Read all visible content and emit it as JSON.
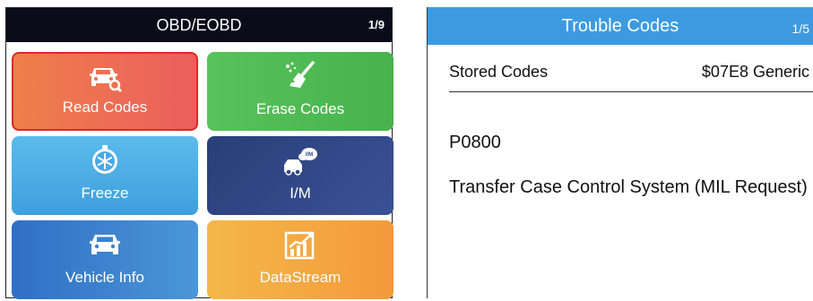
{
  "left_screen": {
    "title": "OBD/EOBD",
    "page": "1/9",
    "tiles": [
      {
        "label": "Read Codes",
        "icon": "car-magnifier-icon",
        "selected": true
      },
      {
        "label": "Erase Codes",
        "icon": "broom-icon"
      },
      {
        "label": "Freeze",
        "icon": "stopwatch-snowflake-icon"
      },
      {
        "label": "I/M",
        "icon": "car-exhaust-im-icon",
        "icon_text": "I/M"
      },
      {
        "label": "Vehicle Info",
        "icon": "car-icon"
      },
      {
        "label": "DataStream",
        "icon": "chart-icon"
      }
    ]
  },
  "right_screen": {
    "title": "Trouble Codes",
    "page": "1/5",
    "stored_label": "Stored Codes",
    "stored_value": "$07E8 Generic",
    "code": "P0800",
    "description": "Transfer Case Control System (MIL Request)"
  },
  "colors": {
    "left_header": "#0b0b1a",
    "right_header": "#3c9be0",
    "read_codes": "#ec6a52",
    "erase_codes": "#4cb84f",
    "freeze": "#4aa9e4",
    "im": "#2f4585",
    "vehicle_info": "#3d82cd",
    "datastream": "#f4a842"
  }
}
